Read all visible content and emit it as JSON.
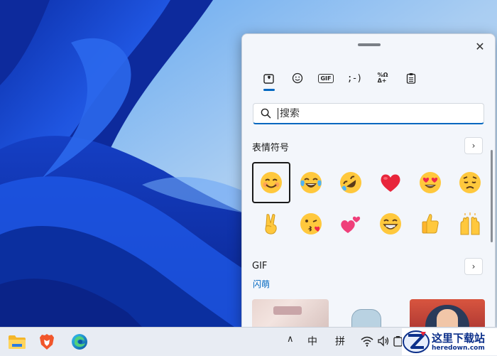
{
  "panel": {
    "close_label": "✕",
    "tabs": [
      {
        "name": "recent",
        "icon": "heart-box-icon",
        "selected": true
      },
      {
        "name": "emoji",
        "icon": "smiley-face-icon"
      },
      {
        "name": "gif",
        "label": "GIF"
      },
      {
        "name": "kaomoji",
        "label": ";-)"
      },
      {
        "name": "symbols",
        "label_top": "%Ω",
        "label_bottom": "Δ+"
      },
      {
        "name": "clipboard",
        "icon": "clipboard-icon"
      }
    ],
    "search": {
      "placeholder": "搜索",
      "value": ""
    },
    "emoji_section": {
      "title": "表情符号",
      "items": [
        "smiling-face-with-smiling-eyes",
        "face-with-tears-of-joy",
        "rolling-on-the-floor-laughing",
        "red-heart",
        "smiling-face-with-heart-eyes",
        "pensive-face",
        "victory-hand",
        "face-blowing-a-kiss",
        "two-hearts",
        "grinning-face-with-smiling-eyes",
        "thumbs-up",
        "raising-hands"
      ],
      "selected_index": 0
    },
    "gif_section": {
      "title": "GIF",
      "subtitle": "闪萌"
    }
  },
  "taskbar": {
    "apps": [
      "file-explorer-icon",
      "brave-browser-icon",
      "edge-browser-icon"
    ],
    "tray": {
      "overflow": "∧",
      "ime_mode": "中",
      "ime_name": "拼"
    }
  },
  "watermark": {
    "title": "这里下载站",
    "url": "heredown.com"
  },
  "colors": {
    "accent": "#0067c0",
    "panel_bg": "#f3f6fb",
    "taskbar_bg": "#e8ecf3"
  }
}
